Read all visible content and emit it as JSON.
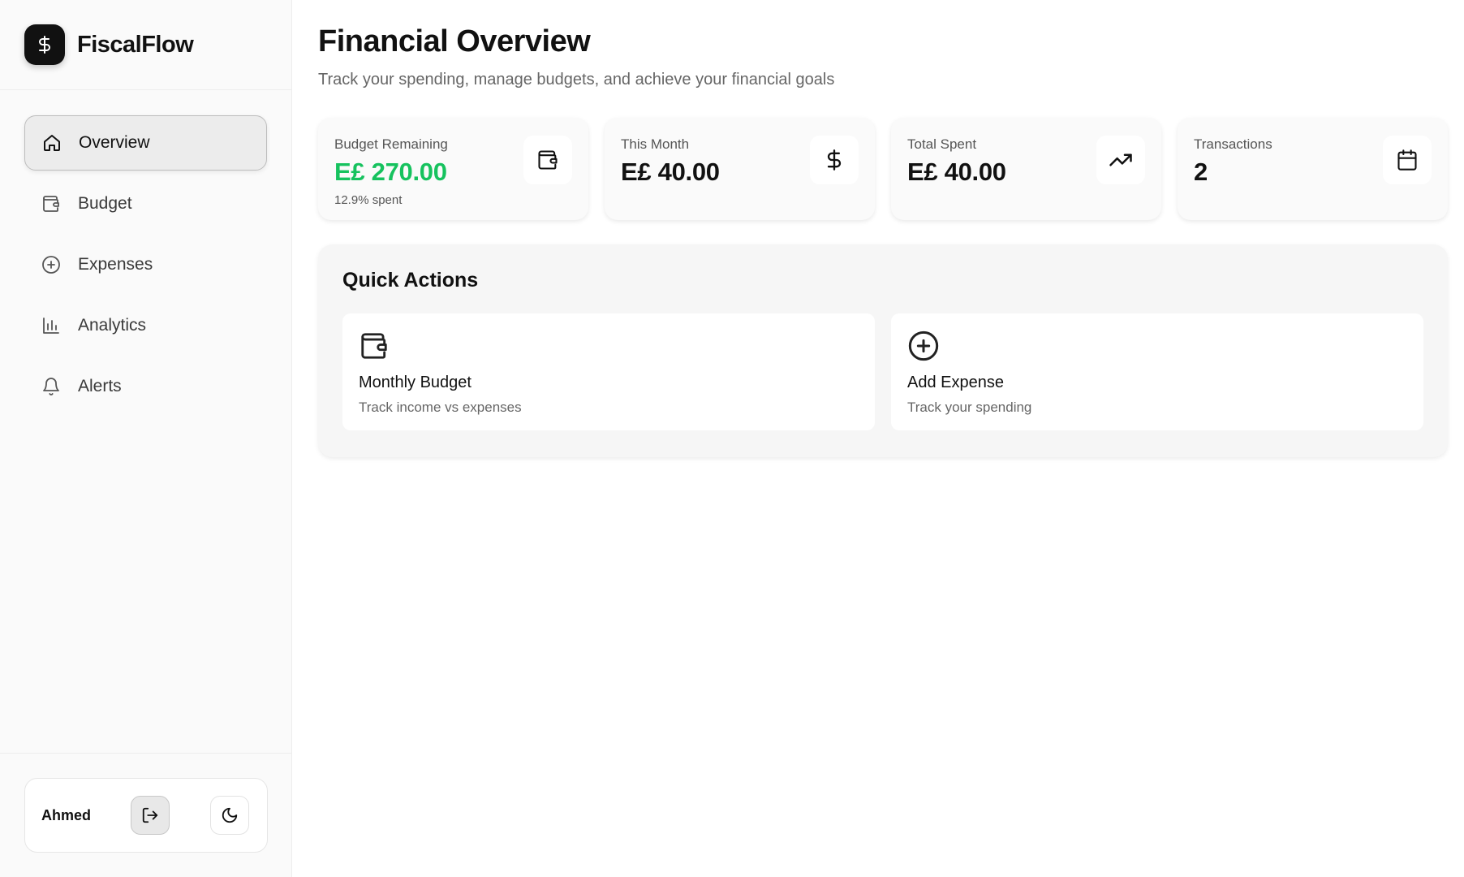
{
  "brand": {
    "name": "FiscalFlow",
    "logo_icon": "dollar-icon"
  },
  "nav": {
    "items": [
      {
        "label": "Overview",
        "icon": "home-icon",
        "active": true
      },
      {
        "label": "Budget",
        "icon": "wallet-icon",
        "active": false
      },
      {
        "label": "Expenses",
        "icon": "plus-circle-icon",
        "active": false
      },
      {
        "label": "Analytics",
        "icon": "bar-chart-icon",
        "active": false
      },
      {
        "label": "Alerts",
        "icon": "bell-icon",
        "active": false
      }
    ]
  },
  "user": {
    "name": "Ahmed",
    "logout_icon": "logout-icon",
    "theme_icon": "moon-icon"
  },
  "header": {
    "title": "Financial Overview",
    "subtitle": "Track your spending, manage budgets, and achieve your financial goals"
  },
  "stats": [
    {
      "label": "Budget Remaining",
      "value": "E£ 270.00",
      "sub": "12.9% spent",
      "icon": "wallet-icon",
      "value_color": "#16c25e"
    },
    {
      "label": "This Month",
      "value": "E£ 40.00",
      "icon": "dollar-icon"
    },
    {
      "label": "Total Spent",
      "value": "E£ 40.00",
      "icon": "trending-up-icon"
    },
    {
      "label": "Transactions",
      "value": "2",
      "icon": "calendar-icon"
    }
  ],
  "quick_actions": {
    "title": "Quick Actions",
    "items": [
      {
        "title": "Monthly Budget",
        "description": "Track income vs expenses",
        "icon": "wallet-icon"
      },
      {
        "title": "Add Expense",
        "description": "Track your spending",
        "icon": "plus-circle-icon"
      }
    ]
  },
  "colors": {
    "accent_green": "#16c25e",
    "active_nav_bg": "#ececec",
    "text_primary": "#111111"
  }
}
